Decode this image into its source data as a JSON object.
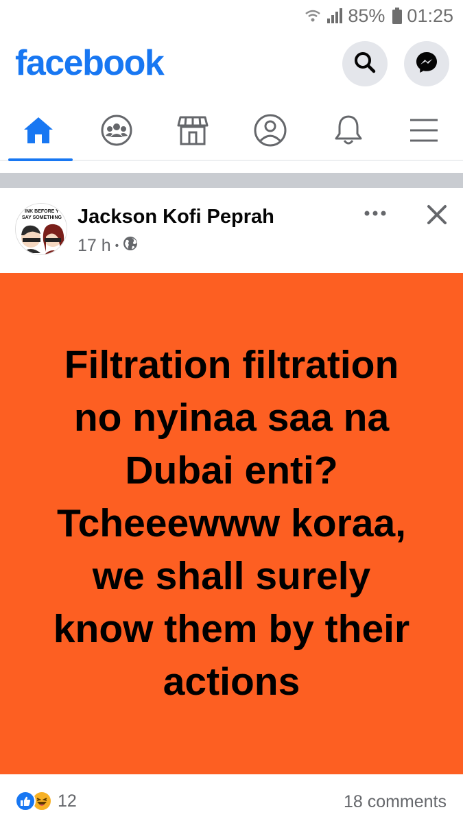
{
  "status_bar": {
    "battery": "85%",
    "time": "01:25",
    "icons": [
      "wifi-icon",
      "signal-icon",
      "battery-icon"
    ]
  },
  "header": {
    "logo": "facebook",
    "brand_color": "#1877f2",
    "buttons": [
      "search-icon",
      "messenger-icon"
    ]
  },
  "nav": {
    "tabs": [
      {
        "name": "home",
        "icon": "home-icon",
        "active": true
      },
      {
        "name": "groups",
        "icon": "groups-icon",
        "active": false
      },
      {
        "name": "marketplace",
        "icon": "marketplace-icon",
        "active": false
      },
      {
        "name": "profile",
        "icon": "profile-icon",
        "active": false
      },
      {
        "name": "notifications",
        "icon": "bell-icon",
        "active": false
      },
      {
        "name": "menu",
        "icon": "menu-icon",
        "active": false
      }
    ]
  },
  "post": {
    "author": "Jackson Kofi Peprah",
    "time": "17 h",
    "privacy_icon": "globe-icon",
    "avatar_text_line1": "INK BEFORE Y",
    "avatar_text_line2": "SAY SOMETHING",
    "background_color": "#fd5f22",
    "text_lines": [
      "Filtration filtration",
      "no nyinaa saa na",
      "Dubai enti?",
      "Tcheeewww koraa,",
      "we shall surely",
      "know them by their",
      "actions"
    ],
    "reaction_count": "12",
    "reactions": [
      "like-icon",
      "haha-icon"
    ],
    "comments": "18 comments"
  }
}
